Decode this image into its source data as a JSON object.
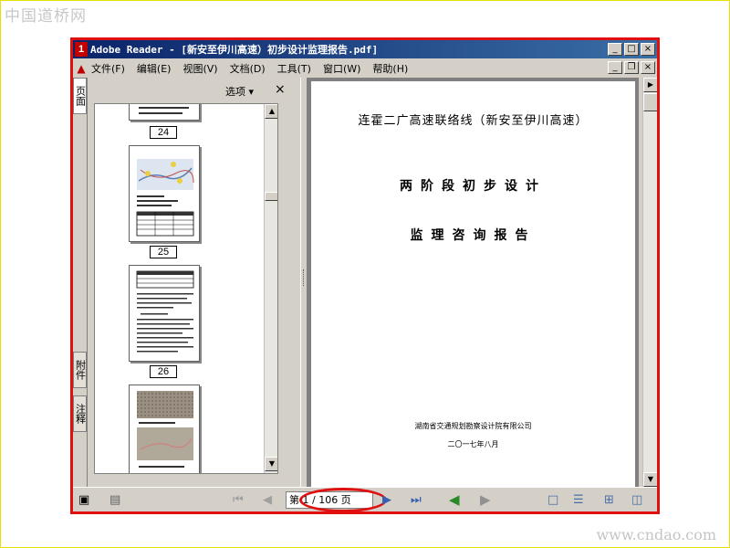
{
  "watermarks": {
    "top": "中国道桥网",
    "bottom": "www.cndao.com"
  },
  "window": {
    "title": "Adobe Reader - [新安至伊川高速）初步设计监理报告.pdf]",
    "app_icon_glyph": "1",
    "buttons": {
      "minimize": "_",
      "maximize": "□",
      "close": "×"
    }
  },
  "menu": {
    "items": [
      "文件(F)",
      "编辑(E)",
      "视图(V)",
      "文档(D)",
      "工具(T)",
      "窗口(W)",
      "帮助(H)"
    ],
    "doc_buttons": {
      "minimize": "_",
      "restore": "❐",
      "close": "×"
    }
  },
  "side_tabs": {
    "pages": "页面",
    "attachments": "附件",
    "comments": "注释"
  },
  "nav_panel": {
    "options_label": "选项 ▾",
    "close_label": "×",
    "thumbnails": [
      "24",
      "25",
      "26"
    ]
  },
  "document": {
    "line1": "连霍二广高速联络线（新安至伊川高速）",
    "line2": "两阶段初步设计",
    "line3": "监理咨询报告",
    "company": "湖南省交通规划勘察设计院有限公司",
    "date": "二〇一七年八月"
  },
  "statusbar": {
    "page_display": "第 1 / 106 页"
  },
  "colors": {
    "title_start": "#0a246a",
    "title_end": "#3a6ea5",
    "highlight": "#e01010",
    "go_green": "#2a8a2a"
  },
  "icons": [
    "save-icon",
    "page-icon",
    "first-page-icon",
    "prev-page-icon",
    "next-page-icon",
    "last-page-icon",
    "back-icon",
    "forward-icon",
    "single-page-icon",
    "continuous-icon",
    "facing-icon",
    "continuous-facing-icon"
  ]
}
